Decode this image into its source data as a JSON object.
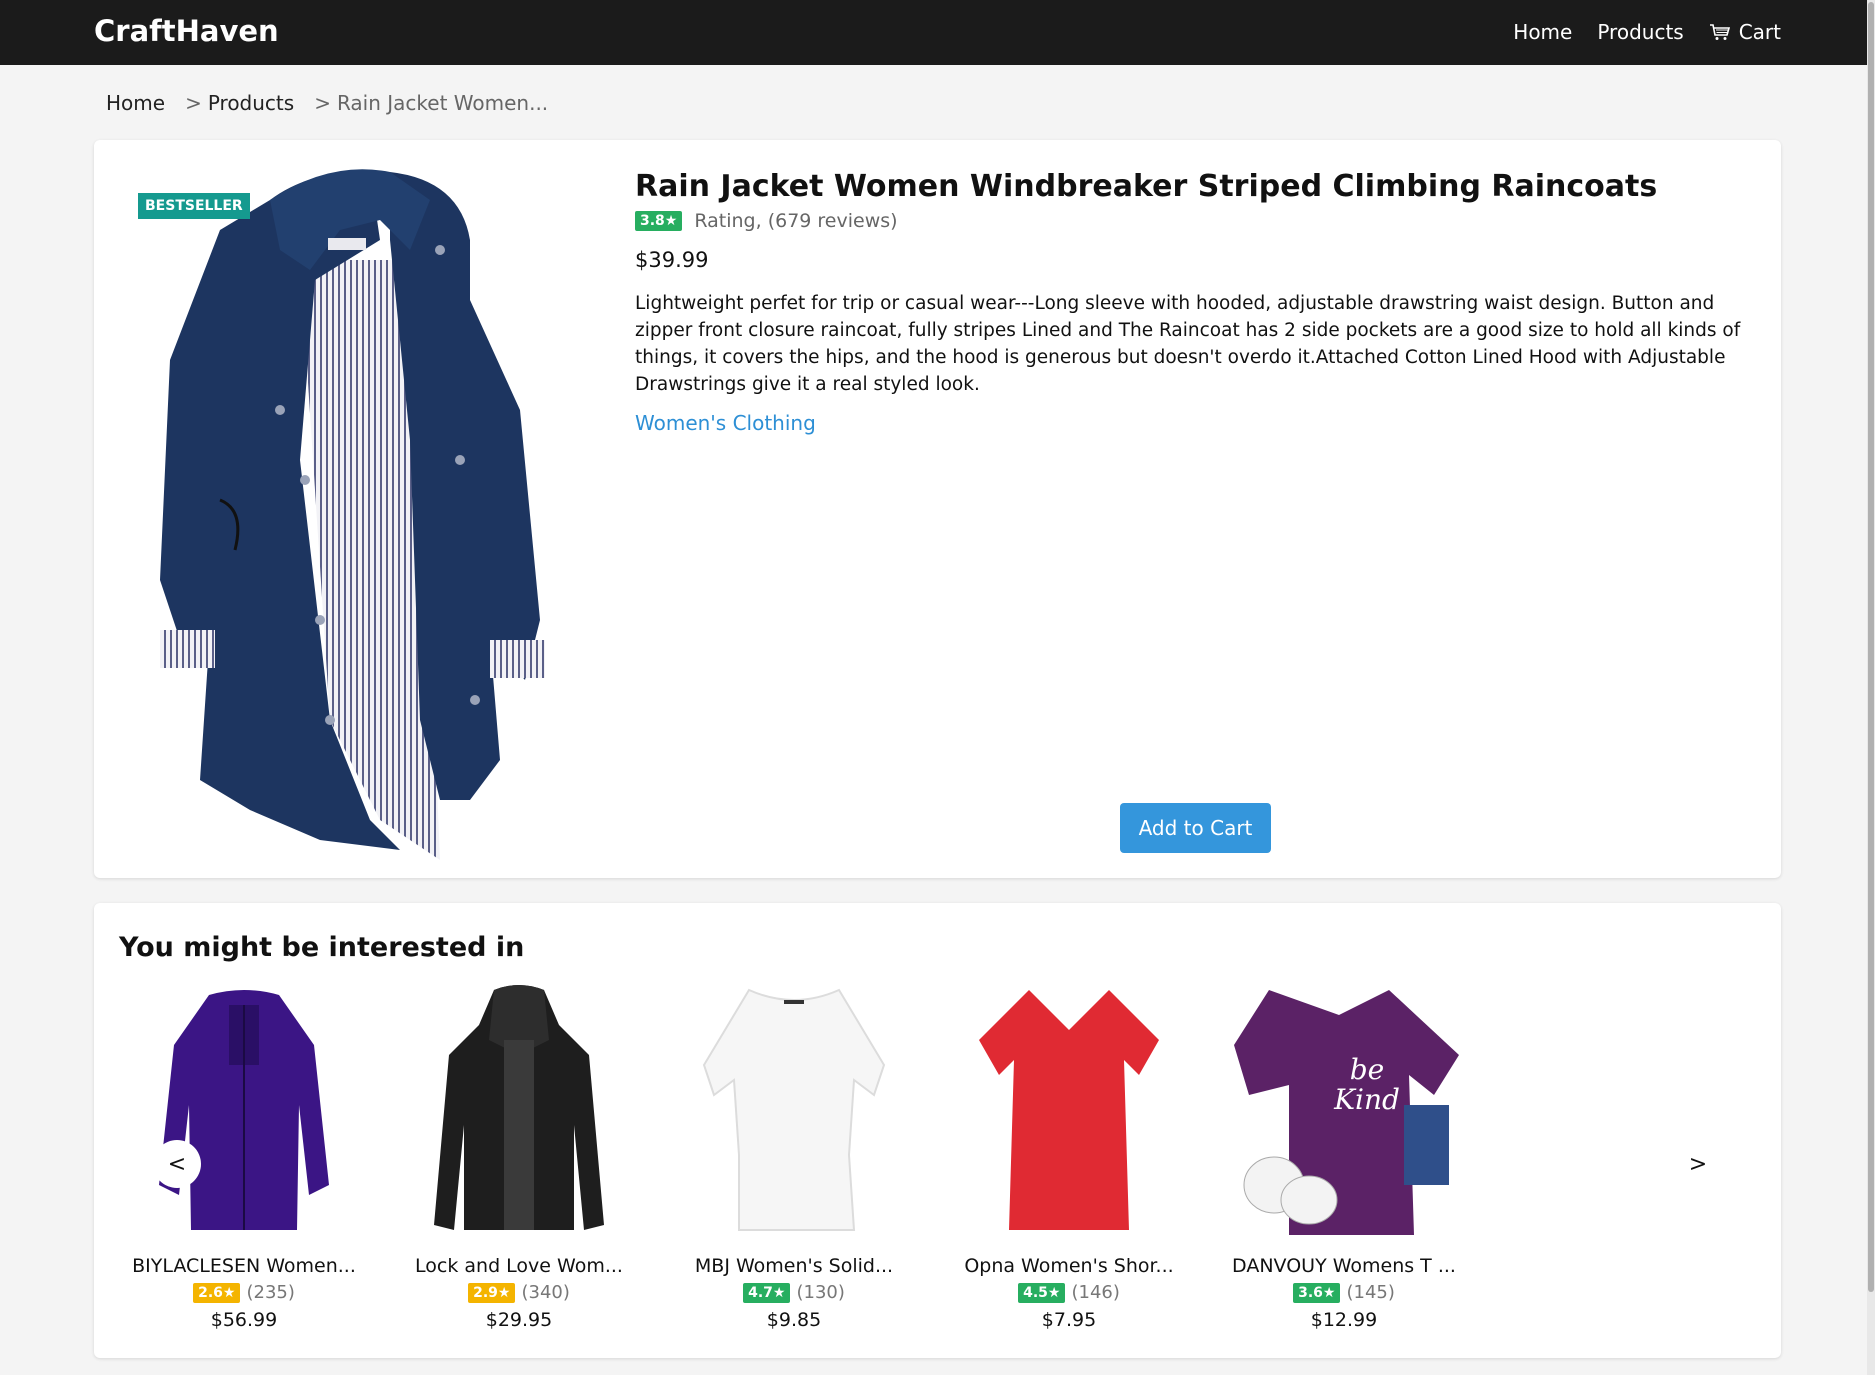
{
  "header": {
    "brand": "CraftHaven",
    "nav": {
      "home": "Home",
      "products": "Products",
      "cart": "Cart"
    }
  },
  "breadcrumb": {
    "home": "Home",
    "products": "Products",
    "current": "Rain Jacket Women...",
    "separator": ">"
  },
  "product": {
    "badge": "BESTSELLER",
    "title": "Rain Jacket Women Windbreaker Striped Climbing Raincoats",
    "rating": "3.8★",
    "rating_color": "#27ae60",
    "rating_text": "Rating, (679 reviews)",
    "price": "$39.99",
    "description": "Lightweight perfet for trip or casual wear---Long sleeve with hooded, adjustable drawstring waist design. Button and zipper front closure raincoat, fully stripes Lined and The Raincoat has 2 side pockets are a good size to hold all kinds of things, it covers the hips, and the hood is generous but doesn't overdo it.Attached Cotton Lined Hood with Adjustable Drawstrings give it a real styled look.",
    "category": "Women's Clothing",
    "add_to_cart": "Add to Cart"
  },
  "recommendations": {
    "title": "You might be interested in",
    "prev": "<",
    "next": ">",
    "items": [
      {
        "name": "BIYLACLESEN Women...",
        "rating": "2.6★",
        "rating_color": "#f4b400",
        "count": "(235)",
        "price": "$56.99",
        "image": "purple-jacket"
      },
      {
        "name": "Lock and Love Wom...",
        "rating": "2.9★",
        "rating_color": "#f4b400",
        "count": "(340)",
        "price": "$29.95",
        "image": "black-leather-jacket"
      },
      {
        "name": "MBJ Women's Solid...",
        "rating": "4.7★",
        "rating_color": "#27ae60",
        "count": "(130)",
        "price": "$9.85",
        "image": "white-top"
      },
      {
        "name": "Opna Women's Shor...",
        "rating": "4.5★",
        "rating_color": "#27ae60",
        "count": "(146)",
        "price": "$7.95",
        "image": "red-tee"
      },
      {
        "name": "DANVOUY Womens T ...",
        "rating": "3.6★",
        "rating_color": "#27ae60",
        "count": "(145)",
        "price": "$12.99",
        "image": "purple-be-kind-tee",
        "image_text": "be Kind"
      }
    ]
  },
  "colors": {
    "header_bg": "#1b1b1b",
    "accent": "#3496dc",
    "badge": "#159a8f",
    "link": "#2d8fd5"
  }
}
